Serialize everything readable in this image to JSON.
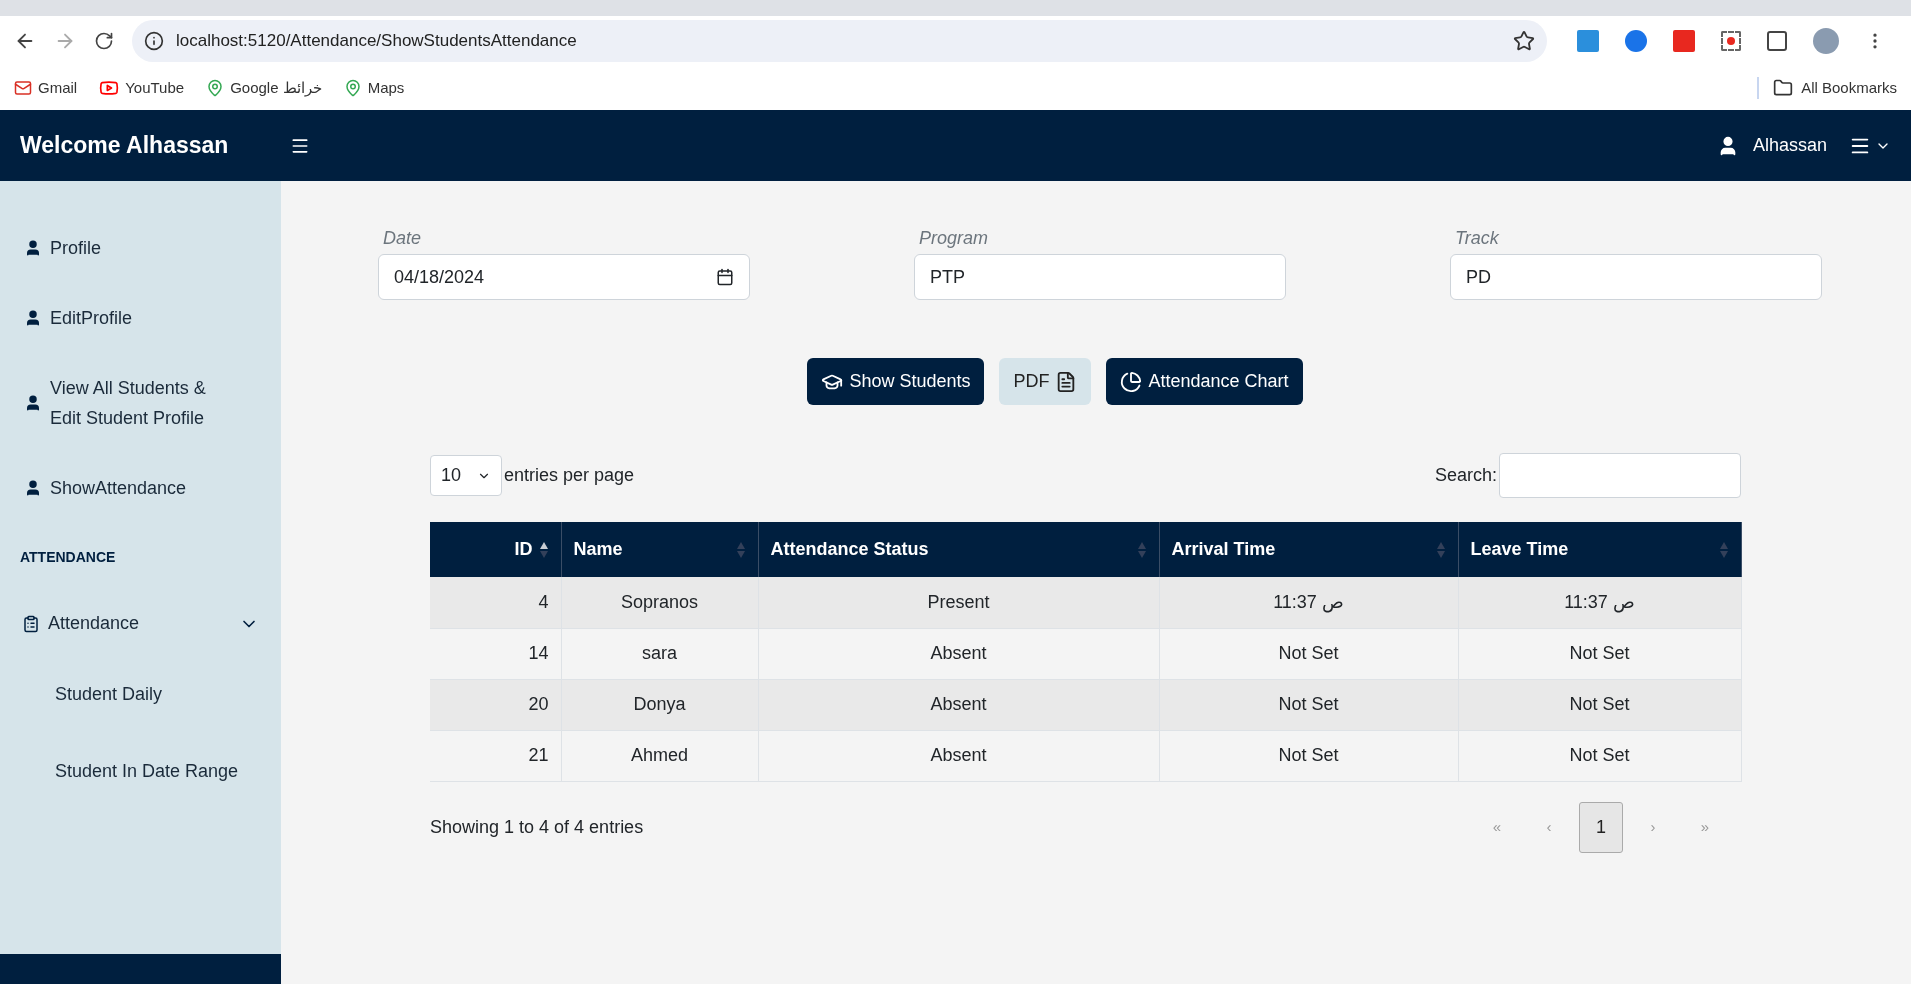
{
  "browser": {
    "url": "localhost:5120/Attendance/ShowStudentsAttendance",
    "bookmarks": [
      {
        "label": "Gmail",
        "kind": "mail"
      },
      {
        "label": "YouTube",
        "kind": "video"
      },
      {
        "label": "Google خرائط",
        "kind": "map"
      },
      {
        "label": "Maps",
        "kind": "map"
      }
    ],
    "all_bookmarks": "All Bookmarks"
  },
  "header": {
    "title": "Welcome Alhassan",
    "user": "Alhassan"
  },
  "sidebar": {
    "items": [
      {
        "label": "Profile"
      },
      {
        "label": "EditProfile"
      },
      {
        "label": "View All Students & Edit Student Profile"
      },
      {
        "label": "ShowAttendance"
      }
    ],
    "section": "ATTENDANCE",
    "group": {
      "label": "Attendance",
      "expanded": true,
      "children": [
        {
          "label": "Student Daily"
        },
        {
          "label": "Student In Date Range"
        }
      ]
    }
  },
  "filters": [
    {
      "label": "Date",
      "value": "04/18/2024",
      "kind": "date"
    },
    {
      "label": "Program",
      "value": "PTP",
      "kind": "text"
    },
    {
      "label": "Track",
      "value": "PD",
      "kind": "text"
    }
  ],
  "buttons": [
    {
      "label": "Show Students",
      "kind": "students"
    },
    {
      "label": "PDF",
      "kind": "pdf"
    },
    {
      "label": "Attendance Chart",
      "kind": "chart"
    }
  ],
  "table": {
    "page_size": "10",
    "page_size_label": "entries per page",
    "search_label": "Search:",
    "columns": [
      {
        "label": "ID",
        "sorted": true
      },
      {
        "label": "Name",
        "sorted": false
      },
      {
        "label": "Attendance Status",
        "sorted": false
      },
      {
        "label": "Arrival Time",
        "sorted": false
      },
      {
        "label": "Leave Time",
        "sorted": false
      }
    ],
    "rows": [
      [
        "4",
        "Sopranos",
        "Present",
        "ص 11:37",
        "ص 11:37"
      ],
      [
        "14",
        "sara",
        "Absent",
        "Not Set",
        "Not Set"
      ],
      [
        "20",
        "Donya",
        "Absent",
        "Not Set",
        "Not Set"
      ],
      [
        "21",
        "Ahmed",
        "Absent",
        "Not Set",
        "Not Set"
      ]
    ],
    "info": "Showing 1 to 4 of 4 entries",
    "pagination": [
      {
        "label": "«",
        "selected": false,
        "disabled": true
      },
      {
        "label": "‹",
        "selected": false,
        "disabled": true
      },
      {
        "label": "1",
        "selected": true,
        "disabled": false
      },
      {
        "label": "›",
        "selected": false,
        "disabled": true
      },
      {
        "label": "»",
        "selected": false,
        "disabled": true
      }
    ]
  }
}
